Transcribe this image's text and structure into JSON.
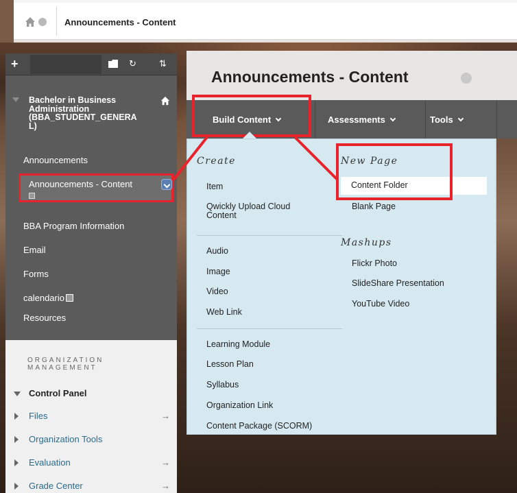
{
  "breadcrumb": {
    "current": "Announcements - Content"
  },
  "sidebar": {
    "course_title": "Bachelor in Business Administration (BBA_STUDENT_GENERAL)",
    "course_title_lines": [
      "Bachelor in Business",
      "Administration",
      "(BBA_STUDENT_GENERA",
      "L)"
    ],
    "items": [
      {
        "label": "Announcements"
      },
      {
        "label": "Announcements - Content"
      },
      {
        "label": "BBA Program Information"
      },
      {
        "label": "Email"
      },
      {
        "label": "Forms"
      },
      {
        "label": "calendario"
      },
      {
        "label": "Resources"
      }
    ]
  },
  "management": {
    "title": "ORGANIZATION MANAGEMENT",
    "control_panel": "Control Panel",
    "items": [
      {
        "label": "Files",
        "arrow": "→"
      },
      {
        "label": "Organization Tools",
        "arrow": ""
      },
      {
        "label": "Evaluation",
        "arrow": "→"
      },
      {
        "label": "Grade Center",
        "arrow": "→"
      }
    ]
  },
  "main": {
    "title": "Announcements - Content",
    "menu": {
      "build_content": "Build Content",
      "assessments": "Assessments",
      "tools": "Tools"
    }
  },
  "dropdown": {
    "create": {
      "label": "Create",
      "items": [
        "Item",
        "Qwickly Upload Cloud Content"
      ],
      "media": [
        "Audio",
        "Image",
        "Video",
        "Web Link"
      ],
      "structure": [
        "Learning Module",
        "Lesson Plan",
        "Syllabus",
        "Organization Link",
        "Content Package (SCORM)"
      ]
    },
    "new_page": {
      "label": "New Page",
      "items": [
        "Content Folder",
        "Blank Page"
      ]
    },
    "mashups": {
      "label": "Mashups",
      "items": [
        "Flickr Photo",
        "SlideShare Presentation",
        "YouTube Video"
      ]
    }
  },
  "colors": {
    "highlight_red": "#e8232b",
    "menu_bg": "#5a5a5a",
    "dropdown_bg": "#d6e9f0",
    "sidebar_bg": "#5b5b5b"
  },
  "icons": [
    "home-icon",
    "circle-chevron-icon",
    "plus-icon",
    "folder-icon",
    "refresh-icon",
    "sort-icon",
    "calendar-icon"
  ]
}
